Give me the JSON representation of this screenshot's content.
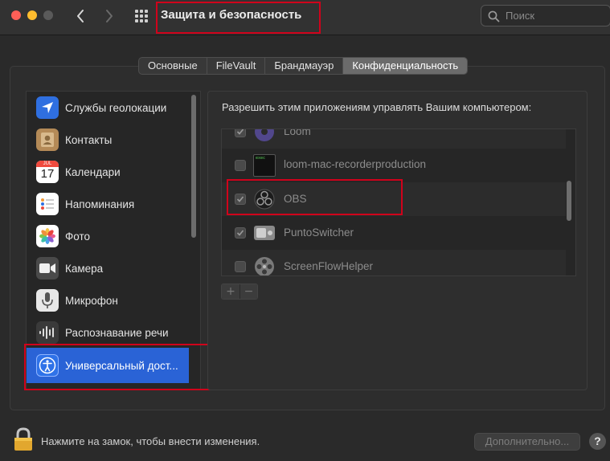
{
  "window": {
    "title": "Защита и безопасность",
    "search_placeholder": "Поиск"
  },
  "tabs": [
    {
      "label": "Основные",
      "active": false
    },
    {
      "label": "FileVault",
      "active": false
    },
    {
      "label": "Брандмауэр",
      "active": false
    },
    {
      "label": "Конфиденциальность",
      "active": true
    }
  ],
  "sidebar": {
    "items": [
      {
        "label": "Службы геолокации",
        "icon": "location-arrow-icon"
      },
      {
        "label": "Контакты",
        "icon": "contacts-icon"
      },
      {
        "label": "Календари",
        "icon": "calendar-icon",
        "icon_month": "JUL",
        "icon_day": "17"
      },
      {
        "label": "Напоминания",
        "icon": "reminders-icon"
      },
      {
        "label": "Фото",
        "icon": "photos-icon"
      },
      {
        "label": "Камера",
        "icon": "camera-icon"
      },
      {
        "label": "Микрофон",
        "icon": "microphone-icon"
      },
      {
        "label": "Распознавание речи",
        "icon": "speech-recognition-icon"
      },
      {
        "label": "Универсальный дост...",
        "icon": "accessibility-icon",
        "selected": true
      }
    ]
  },
  "main": {
    "heading": "Разрешить этим приложениям управлять Вашим компьютером:",
    "apps": [
      {
        "name": "Loom",
        "checked": true,
        "icon": "loom-icon"
      },
      {
        "name": "loom-mac-recorderproduction",
        "checked": false,
        "icon": "terminal-exec-icon",
        "icon_text": "exec"
      },
      {
        "name": "OBS",
        "checked": true,
        "icon": "obs-icon"
      },
      {
        "name": "PuntoSwitcher",
        "checked": true,
        "icon": "punto-switcher-icon"
      },
      {
        "name": "ScreenFlowHelper",
        "checked": false,
        "icon": "screenflow-icon"
      }
    ],
    "add_label": "+",
    "remove_label": "−"
  },
  "footer": {
    "lock_text": "Нажмите на замок, чтобы внести изменения.",
    "advanced_label": "Дополнительно...",
    "help_label": "?"
  },
  "colors": {
    "selection": "#2a63d6",
    "highlight": "#d0021b"
  }
}
